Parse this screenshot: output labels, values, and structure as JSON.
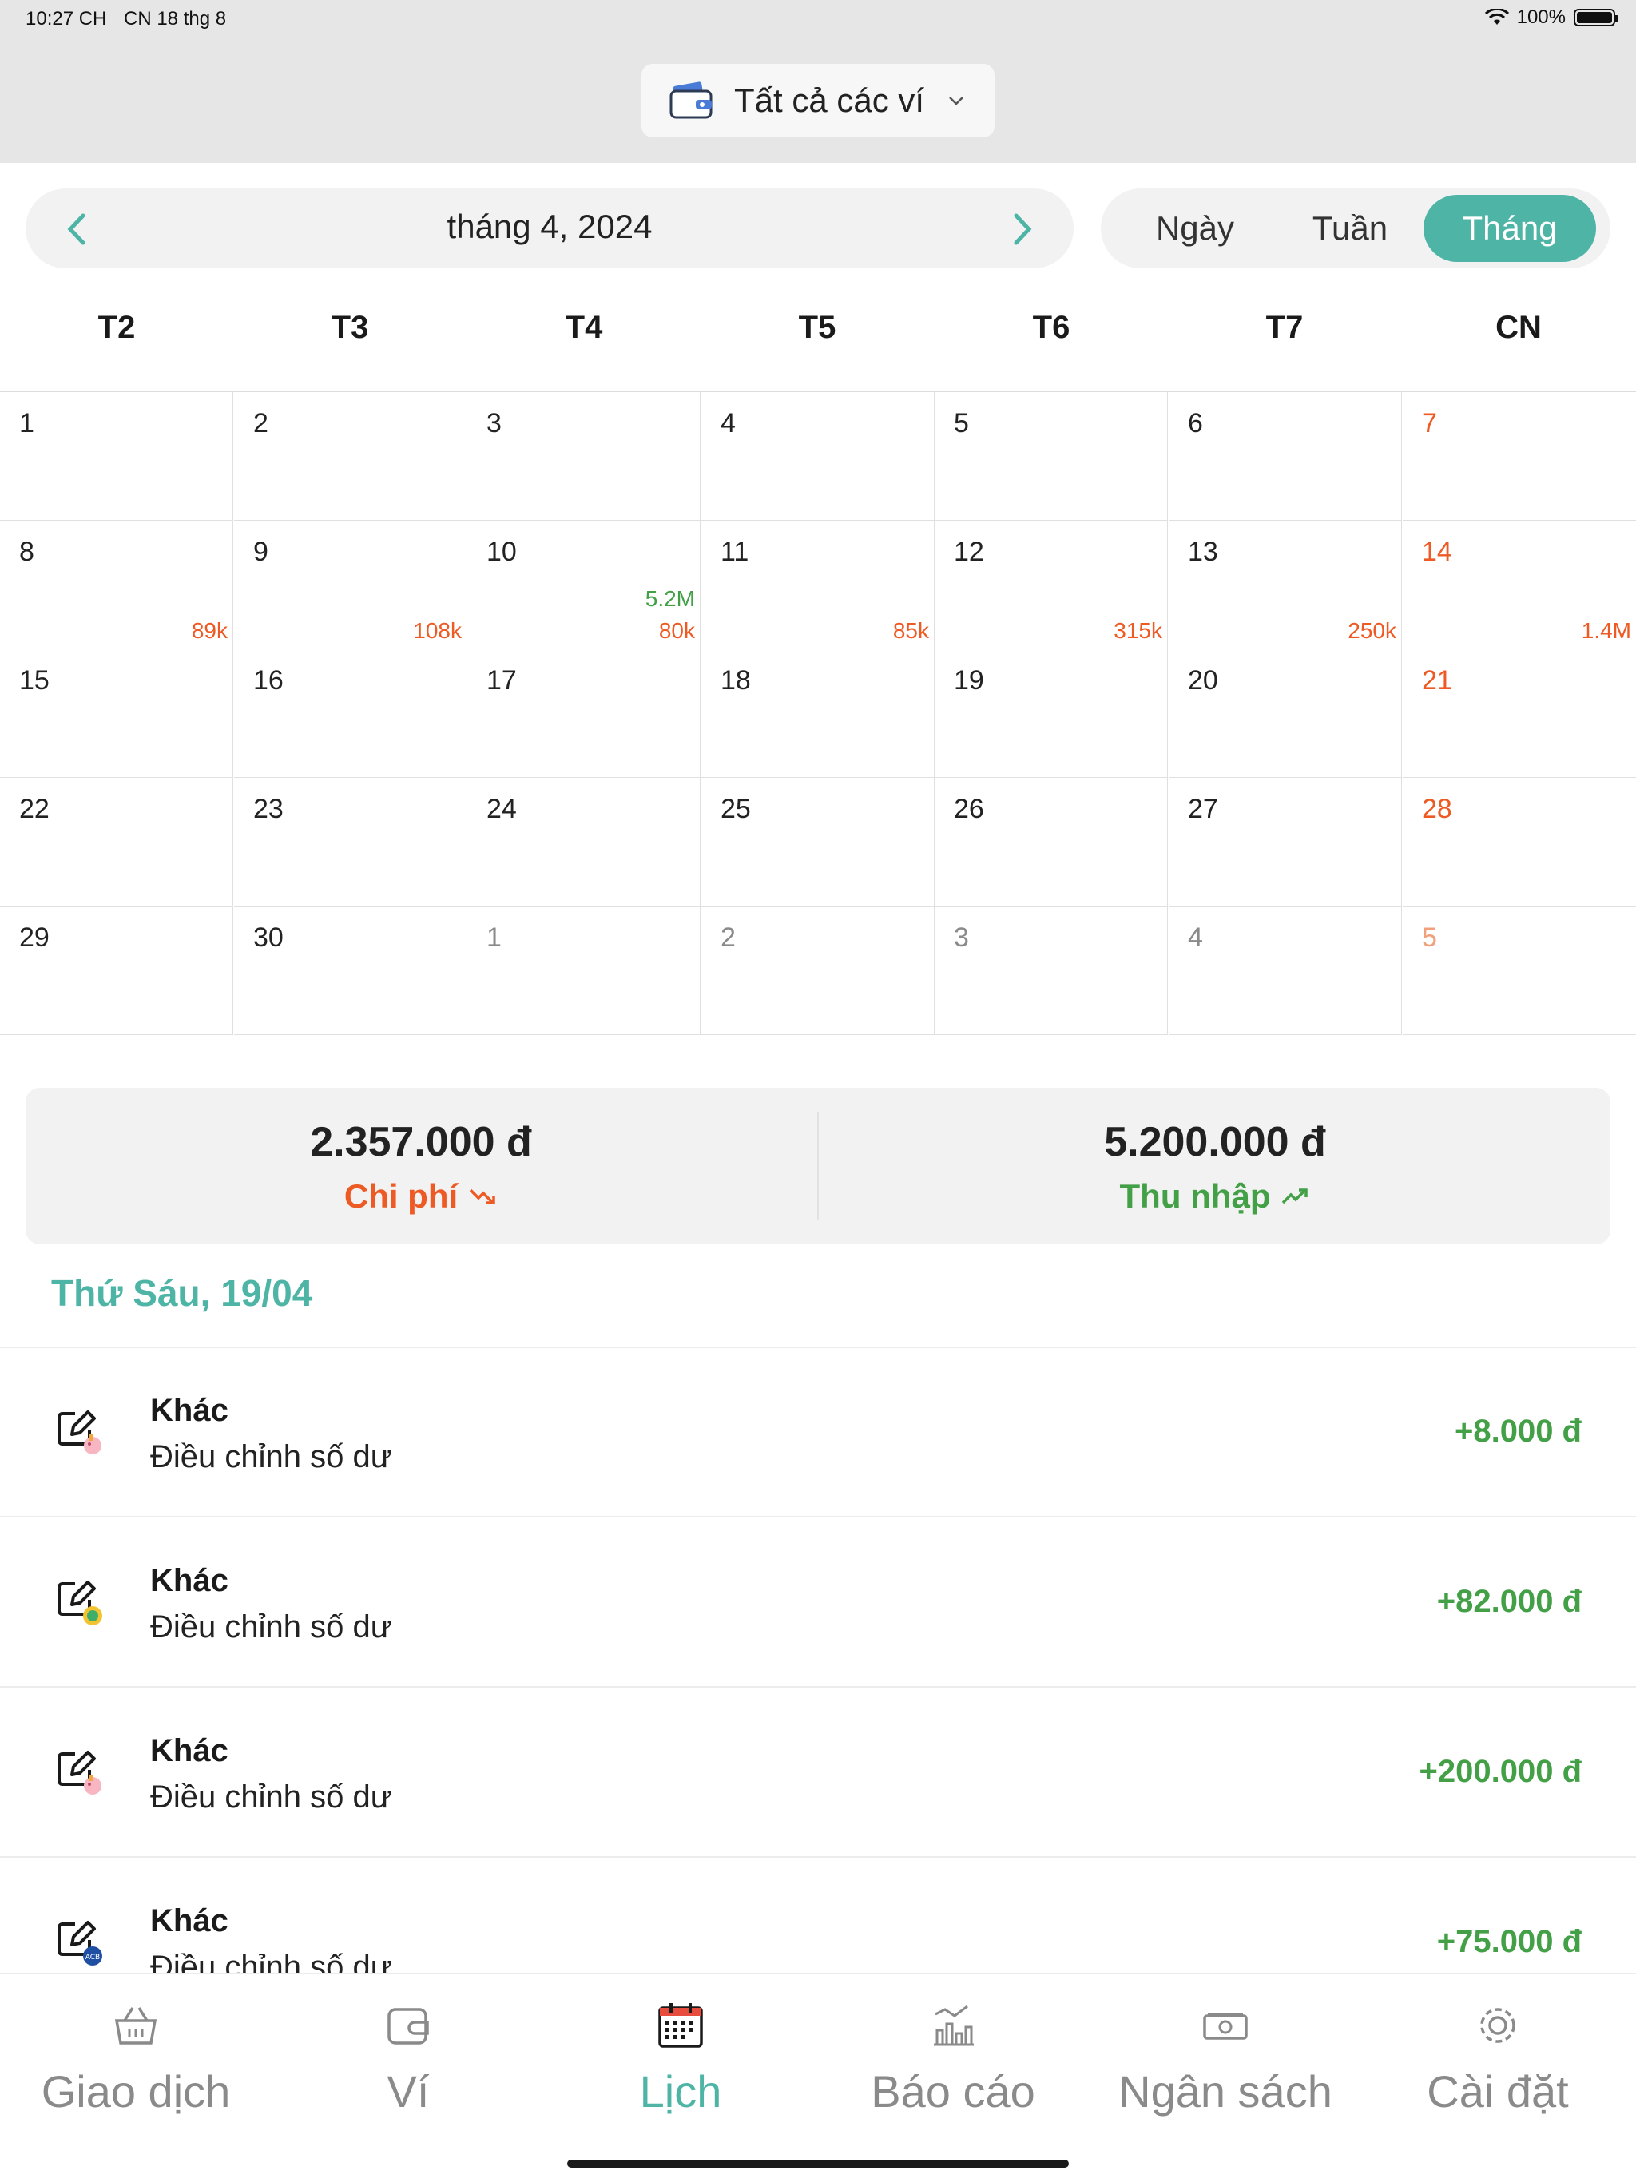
{
  "status_bar": {
    "time": "10:27 CH",
    "date": "CN 18 thg 8",
    "battery": "100%"
  },
  "header": {
    "wallet_label": "Tất cả các ví"
  },
  "month_nav": {
    "title": "tháng 4, 2024"
  },
  "view_toggle": {
    "day": "Ngày",
    "week": "Tuần",
    "month": "Tháng",
    "active": "month"
  },
  "weekdays": [
    "T2",
    "T3",
    "T4",
    "T5",
    "T6",
    "T7",
    "CN"
  ],
  "calendar": {
    "days": [
      {
        "d": "1"
      },
      {
        "d": "2"
      },
      {
        "d": "3"
      },
      {
        "d": "4"
      },
      {
        "d": "5"
      },
      {
        "d": "6"
      },
      {
        "d": "7"
      },
      {
        "d": "8",
        "exp": "89k"
      },
      {
        "d": "9",
        "exp": "108k"
      },
      {
        "d": "10",
        "inc": "5.2M",
        "exp": "80k"
      },
      {
        "d": "11",
        "exp": "85k"
      },
      {
        "d": "12",
        "exp": "315k"
      },
      {
        "d": "13",
        "exp": "250k"
      },
      {
        "d": "14",
        "exp": "1.4M"
      },
      {
        "d": "15"
      },
      {
        "d": "16"
      },
      {
        "d": "17"
      },
      {
        "d": "18"
      },
      {
        "d": "19"
      },
      {
        "d": "20"
      },
      {
        "d": "21"
      },
      {
        "d": "22"
      },
      {
        "d": "23"
      },
      {
        "d": "24"
      },
      {
        "d": "25"
      },
      {
        "d": "26"
      },
      {
        "d": "27"
      },
      {
        "d": "28"
      },
      {
        "d": "29"
      },
      {
        "d": "30"
      },
      {
        "d": "1",
        "other": true
      },
      {
        "d": "2",
        "other": true
      },
      {
        "d": "3",
        "other": true
      },
      {
        "d": "4",
        "other": true
      },
      {
        "d": "5",
        "other": true
      }
    ]
  },
  "summary": {
    "expense_amount": "2.357.000 đ",
    "expense_label": "Chi phí",
    "income_amount": "5.200.000 đ",
    "income_label": "Thu nhập"
  },
  "day_heading": "Thứ Sáu, 19/04",
  "transactions": [
    {
      "category": "Khác",
      "note": "Điều chỉnh số dư",
      "amount": "+8.000 đ",
      "badge": "piggy"
    },
    {
      "category": "Khác",
      "note": "Điều chỉnh số dư",
      "amount": "+82.000 đ",
      "badge": "coin"
    },
    {
      "category": "Khác",
      "note": "Điều chỉnh số dư",
      "amount": "+200.000 đ",
      "badge": "piggy"
    },
    {
      "category": "Khác",
      "note": "Điều chỉnh số dư",
      "amount": "+75.000 đ",
      "badge": "acb"
    }
  ],
  "tabs": [
    {
      "label": "Giao dịch",
      "icon": "basket-icon"
    },
    {
      "label": "Ví",
      "icon": "wallet-icon"
    },
    {
      "label": "Lịch",
      "icon": "calendar-icon",
      "active": true
    },
    {
      "label": "Báo cáo",
      "icon": "report-icon"
    },
    {
      "label": "Ngân sách",
      "icon": "money-icon"
    },
    {
      "label": "Cài đặt",
      "icon": "gear-icon"
    }
  ],
  "colors": {
    "accent": "#4eb5a6",
    "expense": "#ee5a24",
    "income": "#43a047"
  }
}
